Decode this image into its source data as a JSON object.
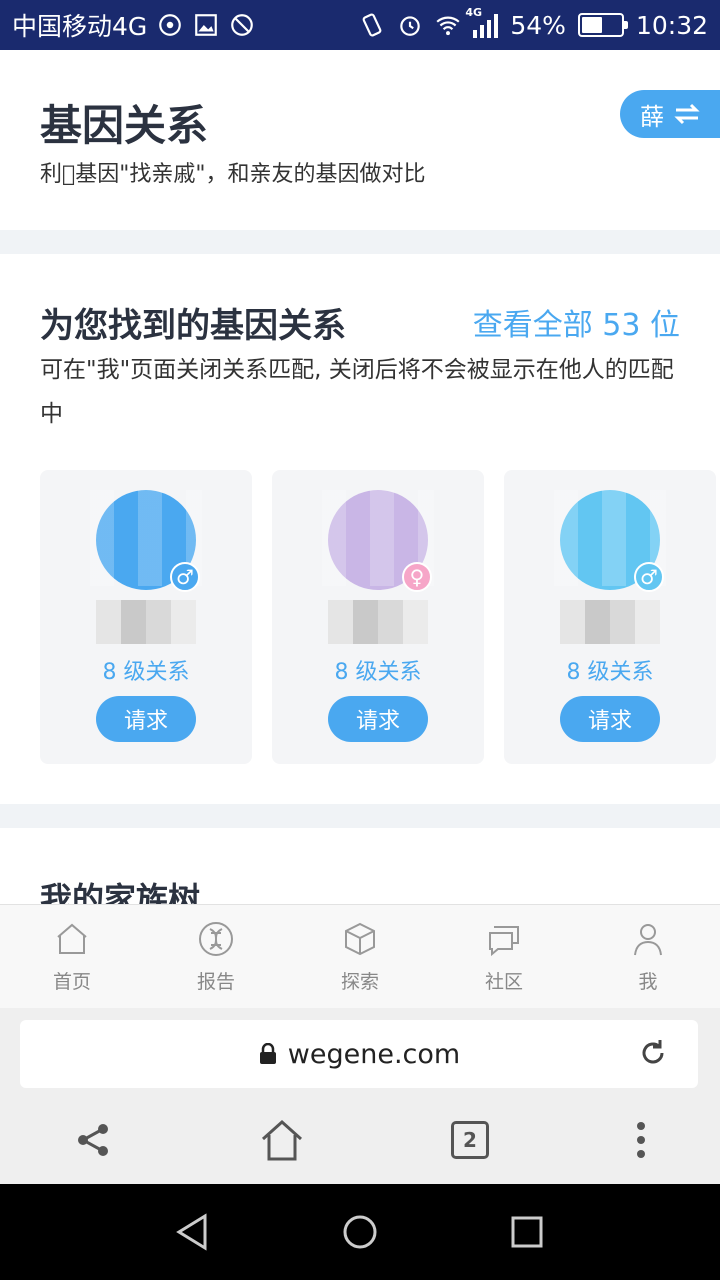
{
  "status_bar": {
    "carrier": "中国移动4G",
    "battery": "54%",
    "battery_level": 0.54,
    "time": "10:32",
    "network_badge": "4G",
    "left_icons": [
      "hotspot-icon",
      "image-icon",
      "no-sim-icon"
    ],
    "right_icons": [
      "vibrate-icon",
      "alarm-icon",
      "wifi-icon",
      "signal-icon",
      "battery-icon"
    ]
  },
  "header": {
    "title": "基因关系",
    "subtitle": "利\u0000基因\"找亲戚\"，和亲友的基因做对比",
    "switch_label": "薛"
  },
  "matches": {
    "title": "为您找到的基因关系",
    "view_all": "查看全部 53 位",
    "description": "可在\"我\"页面关闭关系匹配, 关闭后将不会被显示在他人的匹配中",
    "cards": [
      {
        "level": "8 级关系",
        "request": "请求",
        "gender": "♂",
        "avatar_color": "#4aa8f0",
        "badge_color": "#4aa8f0"
      },
      {
        "level": "8 级关系",
        "request": "请求",
        "gender": "♀",
        "avatar_color": "#c9b6e6",
        "badge_color": "#f6a6c8"
      },
      {
        "level": "8 级关系",
        "request": "请求",
        "gender": "♂",
        "avatar_color": "#62c6f2",
        "badge_color": "#62c6f2"
      }
    ]
  },
  "family_tree": {
    "title": "我的家族树"
  },
  "bottom_nav": [
    {
      "label": "首页",
      "icon": "home-icon"
    },
    {
      "label": "报告",
      "icon": "dna-icon"
    },
    {
      "label": "探索",
      "icon": "cube-icon"
    },
    {
      "label": "社区",
      "icon": "chat-icon"
    },
    {
      "label": "我",
      "icon": "user-icon"
    }
  ],
  "browser": {
    "url": "wegene.com",
    "tab_count": "2"
  },
  "colors": {
    "accent": "#4aa8f0",
    "status_bar": "#1a2a6e"
  }
}
